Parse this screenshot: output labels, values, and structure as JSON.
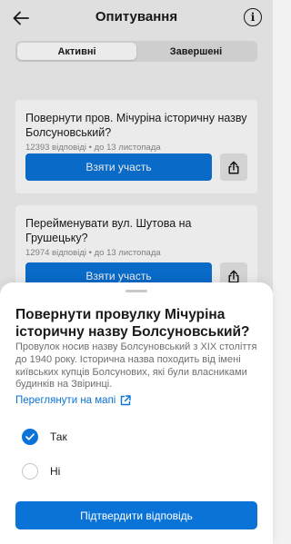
{
  "header": {
    "title": "Опитування",
    "info_glyph": "i",
    "back_icon": "arrow-left-icon",
    "info_icon": "info-icon"
  },
  "tabs": [
    {
      "label": "Активні",
      "active": true
    },
    {
      "label": "Завершені",
      "active": false
    }
  ],
  "polls": [
    {
      "title": "Повернути пров. Мічуріна історичну назву Болсуновський?",
      "meta": "12393 відповіді • до 13 листопада",
      "action_label": "Взяти участь",
      "share_icon": "share-icon"
    },
    {
      "title": "Перейменувати вул. Шутова на Грушецьку?",
      "meta": "12974 відповіді • до 13 листопада",
      "action_label": "Взяти участь",
      "share_icon": "share-icon"
    }
  ],
  "sheet": {
    "title": "Повернути провулку Мічуріна історичну назву Болсуновський?",
    "description": "Провулок носив назву Болсуновський з XIX століття до 1940 року. Історична назва походить від імені київських купців Болсунових, які були власниками будинків на Звіринці.",
    "map_link": "Переглянути на мапі",
    "map_link_icon": "external-link-icon",
    "options": [
      {
        "label": "Так",
        "checked": true
      },
      {
        "label": "Ні",
        "checked": false
      }
    ],
    "confirm_label": "Підтвердити відповідь"
  },
  "colors": {
    "accent": "#0a73d8",
    "background": "#f2f2f2",
    "muted_text": "#8a8a8a"
  }
}
